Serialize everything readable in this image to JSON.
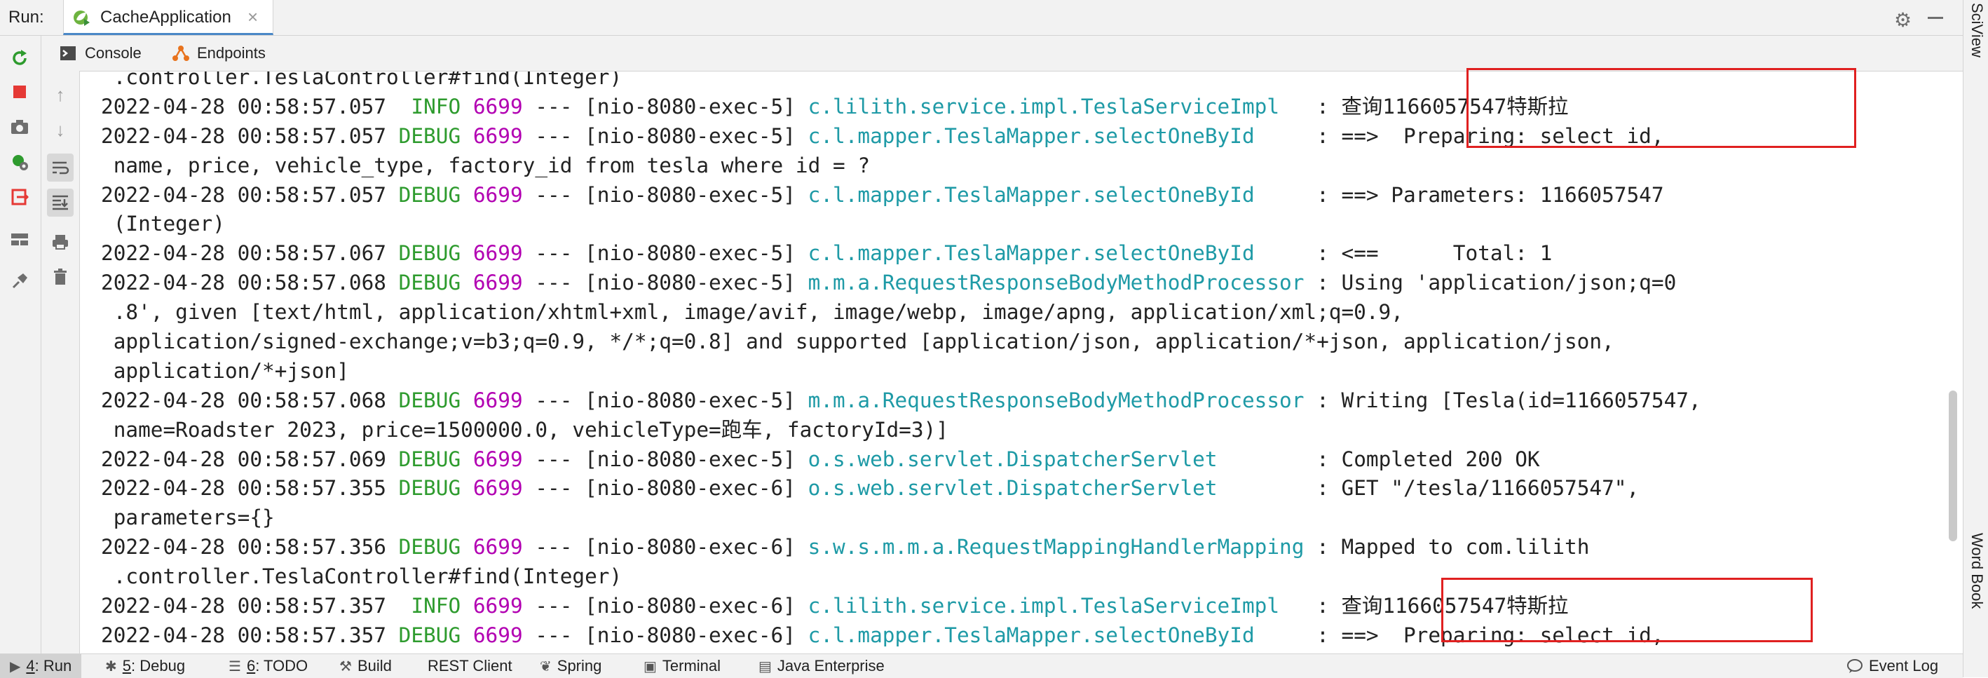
{
  "runbar": {
    "label": "Run:",
    "tab": "CacheApplication",
    "tab_close": "×",
    "gear": "⚙"
  },
  "right_strip": {
    "top_label": "SciView",
    "bottom_label": "Word Book"
  },
  "subtabs": {
    "console": "Console",
    "endpoints": "Endpoints"
  },
  "console_lines": [
    [
      {
        "t": " .controller.TeslaController#find(Integer)",
        "c": ""
      }
    ],
    [
      {
        "t": "2022-04-28 00:58:57.057  ",
        "c": ""
      },
      {
        "t": "INFO",
        "c": "info"
      },
      {
        "t": " ",
        "c": ""
      },
      {
        "t": "6699",
        "c": "pid"
      },
      {
        "t": " --- [nio-8080-exec-5] ",
        "c": ""
      },
      {
        "t": "c.lilith.service.impl.TeslaServiceImpl",
        "c": "log"
      },
      {
        "t": "   : 查询1166057547特斯拉",
        "c": ""
      }
    ],
    [
      {
        "t": "2022-04-28 00:58:57.057 ",
        "c": ""
      },
      {
        "t": "DEBUG",
        "c": "debug"
      },
      {
        "t": " ",
        "c": ""
      },
      {
        "t": "6699",
        "c": "pid"
      },
      {
        "t": " --- [nio-8080-exec-5] ",
        "c": ""
      },
      {
        "t": "c.l.mapper.TeslaMapper.selectOneById",
        "c": "log"
      },
      {
        "t": "     : ==>  Preparing: select id,",
        "c": ""
      }
    ],
    [
      {
        "t": " name, price, vehicle_type, factory_id from tesla where id = ?",
        "c": ""
      }
    ],
    [
      {
        "t": "2022-04-28 00:58:57.057 ",
        "c": ""
      },
      {
        "t": "DEBUG",
        "c": "debug"
      },
      {
        "t": " ",
        "c": ""
      },
      {
        "t": "6699",
        "c": "pid"
      },
      {
        "t": " --- [nio-8080-exec-5] ",
        "c": ""
      },
      {
        "t": "c.l.mapper.TeslaMapper.selectOneById",
        "c": "log"
      },
      {
        "t": "     : ==> Parameters: 1166057547",
        "c": ""
      }
    ],
    [
      {
        "t": " (Integer)",
        "c": ""
      }
    ],
    [
      {
        "t": "2022-04-28 00:58:57.067 ",
        "c": ""
      },
      {
        "t": "DEBUG",
        "c": "debug"
      },
      {
        "t": " ",
        "c": ""
      },
      {
        "t": "6699",
        "c": "pid"
      },
      {
        "t": " --- [nio-8080-exec-5] ",
        "c": ""
      },
      {
        "t": "c.l.mapper.TeslaMapper.selectOneById",
        "c": "log"
      },
      {
        "t": "     : <==      Total: 1",
        "c": ""
      }
    ],
    [
      {
        "t": "2022-04-28 00:58:57.068 ",
        "c": ""
      },
      {
        "t": "DEBUG",
        "c": "debug"
      },
      {
        "t": " ",
        "c": ""
      },
      {
        "t": "6699",
        "c": "pid"
      },
      {
        "t": " --- [nio-8080-exec-5] ",
        "c": ""
      },
      {
        "t": "m.m.a.RequestResponseBodyMethodProcessor",
        "c": "log"
      },
      {
        "t": " : Using 'application/json;q=0",
        "c": ""
      }
    ],
    [
      {
        "t": " .8', given [text/html, application/xhtml+xml, image/avif, image/webp, image/apng, application/xml;q=0.9,",
        "c": ""
      }
    ],
    [
      {
        "t": " application/signed-exchange;v=b3;q=0.9, */*;q=0.8] and supported [application/json, application/*+json, application/json,",
        "c": ""
      }
    ],
    [
      {
        "t": " application/*+json]",
        "c": ""
      }
    ],
    [
      {
        "t": "2022-04-28 00:58:57.068 ",
        "c": ""
      },
      {
        "t": "DEBUG",
        "c": "debug"
      },
      {
        "t": " ",
        "c": ""
      },
      {
        "t": "6699",
        "c": "pid"
      },
      {
        "t": " --- [nio-8080-exec-5] ",
        "c": ""
      },
      {
        "t": "m.m.a.RequestResponseBodyMethodProcessor",
        "c": "log"
      },
      {
        "t": " : Writing [Tesla(id=1166057547,",
        "c": ""
      }
    ],
    [
      {
        "t": " name=Roadster 2023, price=1500000.0, vehicleType=跑车, factoryId=3)]",
        "c": ""
      }
    ],
    [
      {
        "t": "2022-04-28 00:58:57.069 ",
        "c": ""
      },
      {
        "t": "DEBUG",
        "c": "debug"
      },
      {
        "t": " ",
        "c": ""
      },
      {
        "t": "6699",
        "c": "pid"
      },
      {
        "t": " --- [nio-8080-exec-5] ",
        "c": ""
      },
      {
        "t": "o.s.web.servlet.DispatcherServlet",
        "c": "log"
      },
      {
        "t": "        : Completed 200 OK",
        "c": ""
      }
    ],
    [
      {
        "t": "2022-04-28 00:58:57.355 ",
        "c": ""
      },
      {
        "t": "DEBUG",
        "c": "debug"
      },
      {
        "t": " ",
        "c": ""
      },
      {
        "t": "6699",
        "c": "pid"
      },
      {
        "t": " --- [nio-8080-exec-6] ",
        "c": ""
      },
      {
        "t": "o.s.web.servlet.DispatcherServlet",
        "c": "log"
      },
      {
        "t": "        : GET \"/tesla/1166057547\",",
        "c": ""
      }
    ],
    [
      {
        "t": " parameters={}",
        "c": ""
      }
    ],
    [
      {
        "t": "2022-04-28 00:58:57.356 ",
        "c": ""
      },
      {
        "t": "DEBUG",
        "c": "debug"
      },
      {
        "t": " ",
        "c": ""
      },
      {
        "t": "6699",
        "c": "pid"
      },
      {
        "t": " --- [nio-8080-exec-6] ",
        "c": ""
      },
      {
        "t": "s.w.s.m.m.a.RequestMappingHandlerMapping",
        "c": "log"
      },
      {
        "t": " : Mapped to com.lilith",
        "c": ""
      }
    ],
    [
      {
        "t": " .controller.TeslaController#find(Integer)",
        "c": ""
      }
    ],
    [
      {
        "t": "2022-04-28 00:58:57.357  ",
        "c": ""
      },
      {
        "t": "INFO",
        "c": "info"
      },
      {
        "t": " ",
        "c": ""
      },
      {
        "t": "6699",
        "c": "pid"
      },
      {
        "t": " --- [nio-8080-exec-6] ",
        "c": ""
      },
      {
        "t": "c.lilith.service.impl.TeslaServiceImpl",
        "c": "log"
      },
      {
        "t": "   : 查询1166057547特斯拉",
        "c": ""
      }
    ],
    [
      {
        "t": "2022-04-28 00:58:57.357 ",
        "c": ""
      },
      {
        "t": "DEBUG",
        "c": "debug"
      },
      {
        "t": " ",
        "c": ""
      },
      {
        "t": "6699",
        "c": "pid"
      },
      {
        "t": " --- [nio-8080-exec-6] ",
        "c": ""
      },
      {
        "t": "c.l.mapper.TeslaMapper.selectOneById",
        "c": "log"
      },
      {
        "t": "     : ==>  Preparing: select id,",
        "c": ""
      }
    ]
  ],
  "bottom_tabs": [
    {
      "num": "4",
      "label": ": Run",
      "icon": "play-icon",
      "glyph": "▶",
      "active": true
    },
    {
      "num": "5",
      "label": ": Debug",
      "icon": "bug-icon",
      "glyph": "✱",
      "active": false
    },
    {
      "num": "6",
      "label": ": TODO",
      "icon": "list-icon",
      "glyph": "☰",
      "active": false
    },
    {
      "num": "",
      "label": "Build",
      "icon": "hammer-icon",
      "glyph": "⚒",
      "active": false
    },
    {
      "num": "",
      "label": "REST Client",
      "icon": "",
      "glyph": "",
      "active": false
    },
    {
      "num": "",
      "label": "Spring",
      "icon": "spring-leaf-icon",
      "glyph": "❦",
      "active": false
    },
    {
      "num": "",
      "label": "Terminal",
      "icon": "terminal-icon",
      "glyph": "▣",
      "active": false
    },
    {
      "num": "",
      "label": "Java Enterprise",
      "icon": "java-enterprise-icon",
      "glyph": "▤",
      "active": false
    }
  ],
  "event_log": "Event Log",
  "colors": {
    "info": "#2e9b2e",
    "debug": "#2e9b2e",
    "pid": "#b200b2",
    "logger": "#1e9aa6",
    "highlight": "#e02020"
  }
}
